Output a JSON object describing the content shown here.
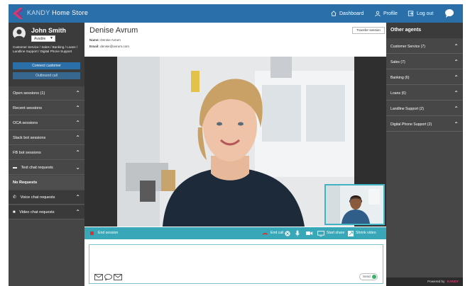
{
  "header": {
    "brand_prefix": "KANDY",
    "brand_name": "Home Store",
    "nav": {
      "dashboard": "Dashboard",
      "profile": "Profile",
      "logout": "Log out"
    }
  },
  "agent": {
    "name": "John Smith",
    "status": "Avaible",
    "skills": "Customer Service / Sales / Banking / Loans / Landline Support / Digital Phone Support",
    "connect_label": "Connect customer",
    "outbound_label": "Outbound call"
  },
  "left_sections": [
    {
      "label": "Open sessions (1)"
    },
    {
      "label": "Recent sessions"
    },
    {
      "label": "OCA sessions"
    },
    {
      "label": "Slack bot sessions"
    },
    {
      "label": "FB bot sessions"
    },
    {
      "label": "Text chat requests"
    },
    {
      "label": "Voice chat requests"
    },
    {
      "label": "Video chat requests"
    }
  ],
  "no_requests": "No Requests",
  "contact": {
    "name": "Denise Avrum",
    "name_label": "Name:",
    "name_value": "Denise Avrum",
    "email_label": "Email:",
    "email_value": "denise@avrum.com",
    "transfer_label": "Transfer session"
  },
  "controls": {
    "end_session": "End session",
    "end_call": "End call",
    "start_share": "Start share",
    "shrink_video": "Shrink video"
  },
  "composer": {
    "send_label": "Send"
  },
  "other_agents": {
    "title": "Other agents",
    "groups": [
      {
        "label": "Customer Service (7)"
      },
      {
        "label": "Sales (7)"
      },
      {
        "label": "Banking (6)"
      },
      {
        "label": "Loans (6)"
      },
      {
        "label": "Landline Support (2)"
      },
      {
        "label": "Digital Phone Support (2)"
      }
    ],
    "powered_by": "Powered by",
    "powered_brand": "KANDY"
  },
  "colors": {
    "header_blue": "#2a6fa8",
    "teal": "#38a7b7",
    "sidebar_dark": "#474747",
    "end_red": "#d93232"
  }
}
